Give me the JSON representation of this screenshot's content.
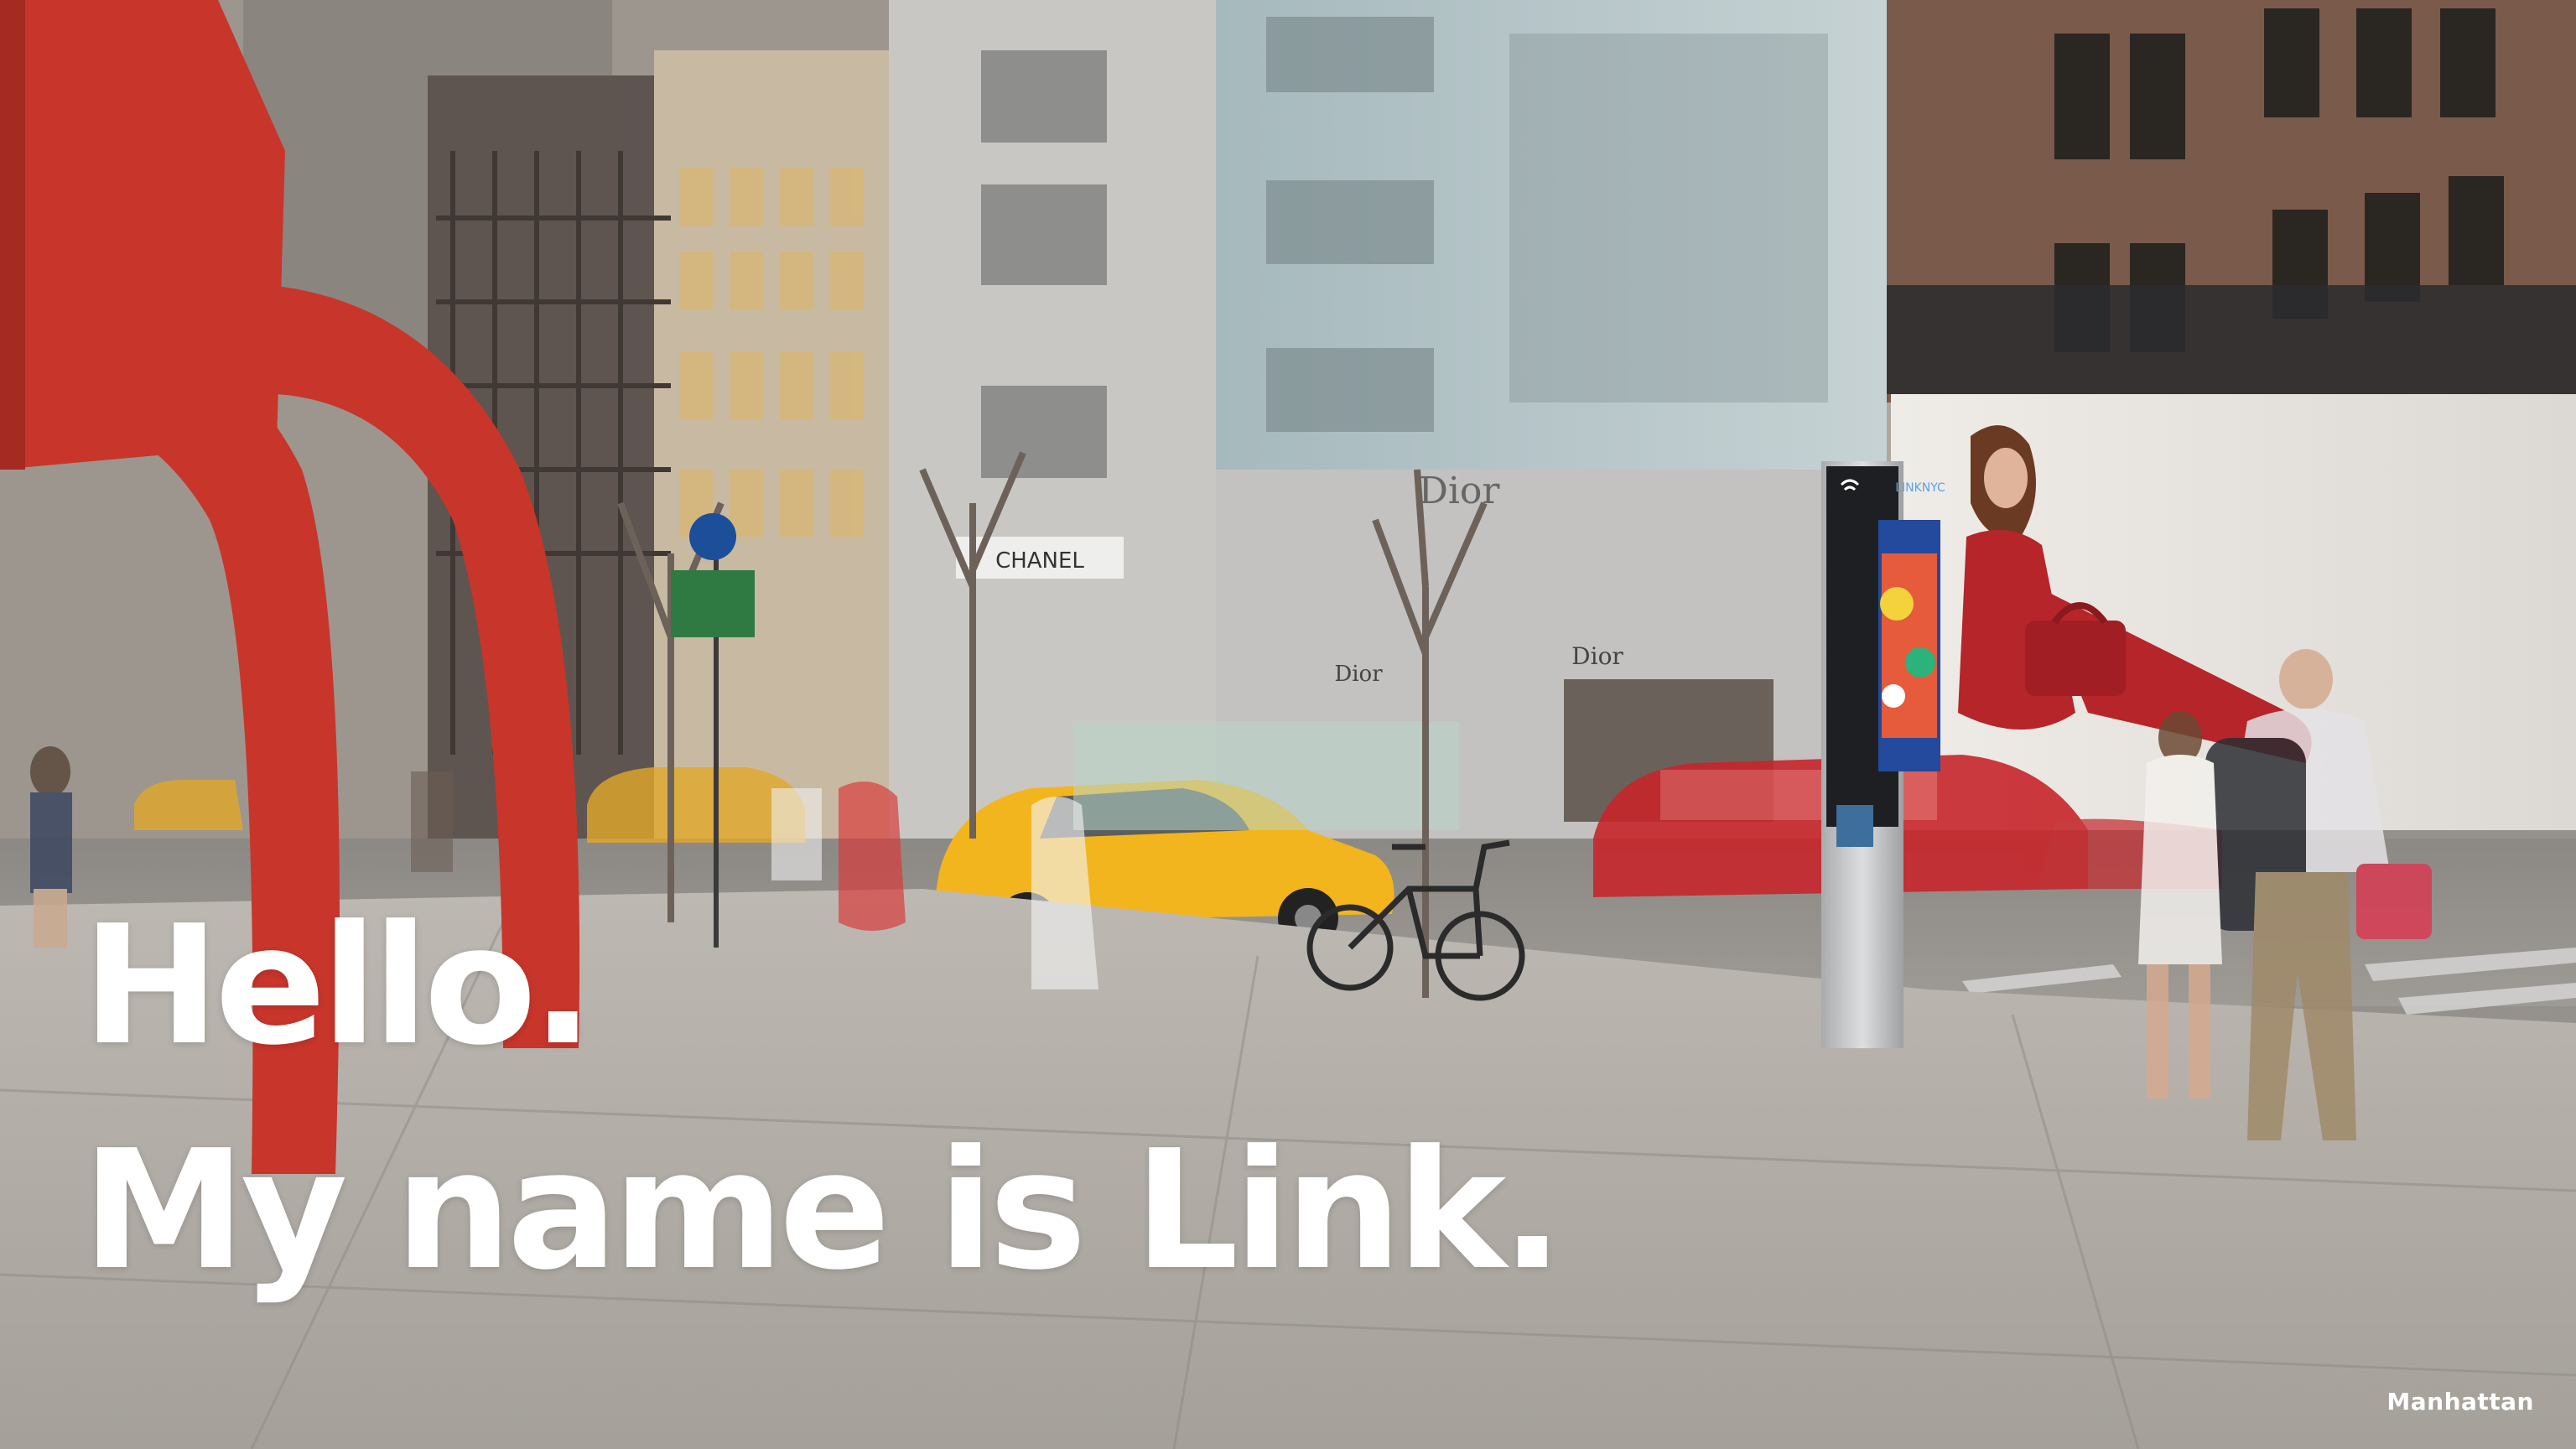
{
  "headline": {
    "line1": "Hello.",
    "line2": "My name is Link."
  },
  "caption": {
    "location": "Manhattan"
  },
  "storefront_signs": {
    "chanel": "CHANEL",
    "dior_top": "Dior",
    "dior_left": "Dior",
    "dior_right": "Dior"
  },
  "kiosk": {
    "brand": "LINKNYC"
  },
  "colors": {
    "sculpture_red": "#c8352b",
    "taxi_yellow": "#f2b51d",
    "kiosk_silver": "#c9cacb",
    "headline_white": "#ffffff"
  }
}
